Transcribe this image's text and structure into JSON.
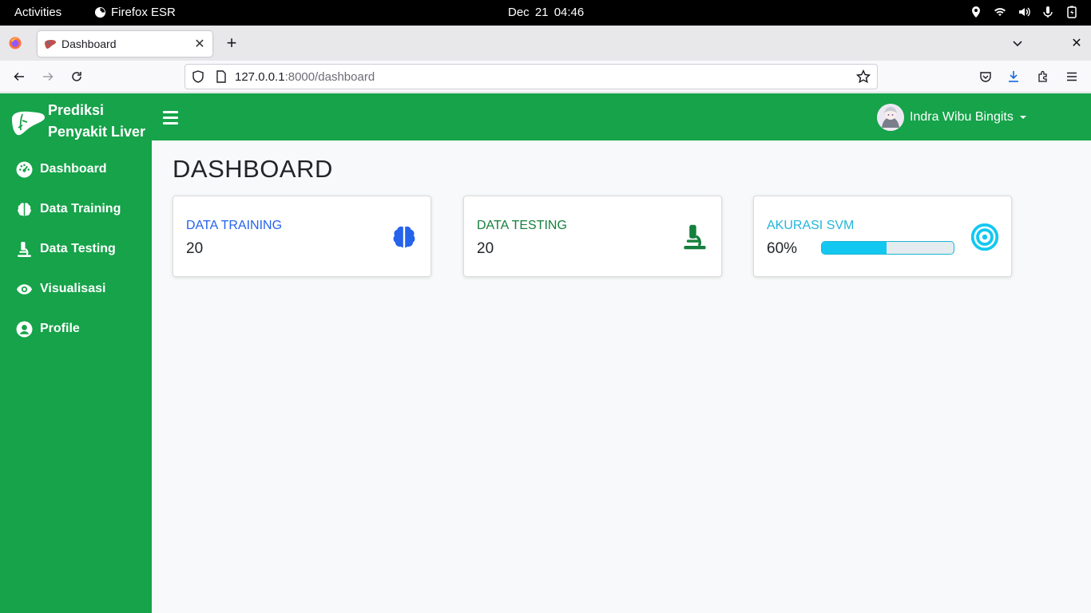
{
  "system_bar": {
    "activities": "Activities",
    "app_name": "Firefox ESR",
    "clock": "Dec 21  04:46"
  },
  "browser": {
    "tab_title": "Dashboard",
    "url_host": "127.0.0.1",
    "url_path": ":8000/dashboard"
  },
  "brand": {
    "line1": "Prediksi",
    "line2": "Penyakit Liver"
  },
  "sidebar": {
    "items": [
      {
        "label": "Dashboard",
        "icon": "gauge-icon"
      },
      {
        "label": "Data Training",
        "icon": "brain-icon"
      },
      {
        "label": "Data Testing",
        "icon": "microscope-icon"
      },
      {
        "label": "Visualisasi",
        "icon": "eye-icon"
      },
      {
        "label": "Profile",
        "icon": "user-circle-icon"
      }
    ]
  },
  "header": {
    "username": "Indra Wibu Bingits"
  },
  "main": {
    "title": "DASHBOARD",
    "cards": {
      "training": {
        "label": "DATA TRAINING",
        "value": "20",
        "icon": "brain-icon"
      },
      "testing": {
        "label": "DATA TESTING",
        "value": "20",
        "icon": "microscope-icon"
      },
      "svm": {
        "label": "AKURASI SVM",
        "value": "60%",
        "progress_fraction": 0.49,
        "icon": "bullseye-icon"
      }
    }
  },
  "colors": {
    "primary": "#16a34a",
    "training": "#2563eb",
    "testing": "#15803d",
    "svm": "#22b6d8"
  }
}
